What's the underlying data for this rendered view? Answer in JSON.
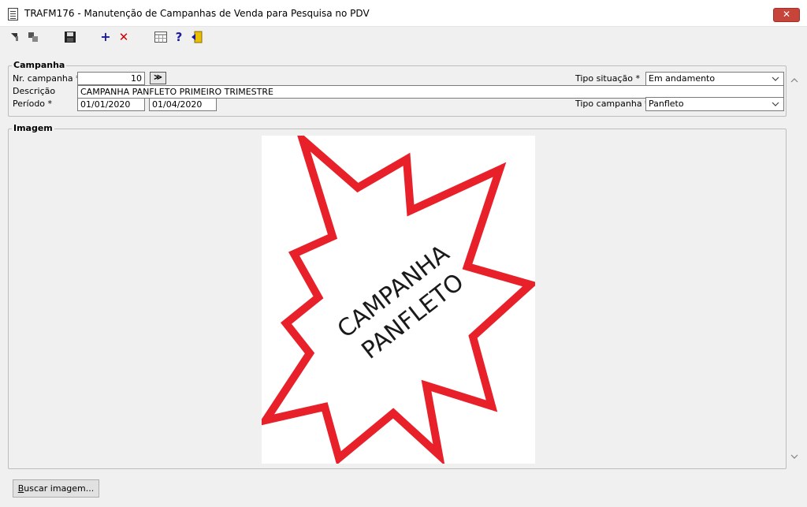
{
  "window": {
    "title": "TRAFM176 - Manutenção de Campanhas de Venda para Pesquisa no PDV",
    "close_label": "✕"
  },
  "toolbar": {
    "items": [
      {
        "name": "prev-record",
        "icon": "arrow-back-icon"
      },
      {
        "name": "next-record",
        "icon": "arrow-forward-icon"
      },
      {
        "name": "save",
        "icon": "floppy-disk-icon"
      },
      {
        "name": "add",
        "icon": "plus-icon",
        "label": "+"
      },
      {
        "name": "delete",
        "icon": "delete-x-icon",
        "label": "✕"
      },
      {
        "name": "calendar",
        "icon": "calendar-grid-icon"
      },
      {
        "name": "help",
        "icon": "help-icon",
        "label": "?"
      },
      {
        "name": "exit",
        "icon": "exit-door-icon"
      }
    ]
  },
  "campanha": {
    "legend": "Campanha",
    "nr_label": "Nr. campanha *",
    "nr_value": "10",
    "lookup_label": "≫",
    "descricao_label": "Descrição",
    "descricao_value": "CAMPANHA PANFLETO PRIMEIRO TRIMESTRE",
    "periodo_label": "Período *",
    "periodo_inicio": "01/01/2020",
    "periodo_fim": "01/04/2020",
    "tipo_situacao_label": "Tipo situação *",
    "tipo_situacao_value": "Em andamento",
    "tipo_campanha_label": "Tipo campanha *",
    "tipo_campanha_value": "Panfleto"
  },
  "imagem": {
    "legend": "Imagem",
    "image_text_line1": "CAMPANHA",
    "image_text_line2": "PANFLETO",
    "star_color": "#e8202a"
  },
  "buttons": {
    "buscar_imagem": "Buscar imagem..."
  }
}
